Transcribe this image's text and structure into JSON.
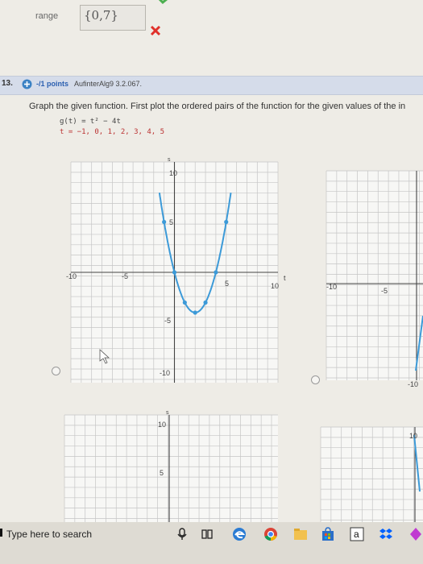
{
  "answer": {
    "range_label": "range",
    "range_value": "{0,7}",
    "status_icon": "wrong-icon",
    "status_color": "#e0302a"
  },
  "question": {
    "number": "13.",
    "points": "-/1 points",
    "code": "AufinterAlg9 3.2.067.",
    "prompt": "Graph the given function. First plot the ordered pairs of the function for the given values of the in",
    "function_text": "g(t) = t² − 4t",
    "t_values_text": "t = −1, 0, 1, 2, 3, 4, 5"
  },
  "graphs": {
    "y_axis_label": "s",
    "x_axis_label": "t",
    "tick_labels": {
      "main_x": [
        "-10",
        "-5",
        "5",
        "10"
      ],
      "main_y": [
        "10",
        "5",
        "-5",
        "-10"
      ],
      "second_x": [
        "-10",
        "-5"
      ],
      "bottom_y": [
        "10",
        "5"
      ],
      "partial": [
        "10",
        "-10"
      ]
    }
  },
  "chart_data": {
    "type": "line",
    "title": "",
    "xlabel": "t",
    "ylabel": "s",
    "xlim": [
      -10,
      10
    ],
    "ylim": [
      -10,
      10
    ],
    "grid": true,
    "series": [
      {
        "x": [
          -1,
          0,
          1,
          2,
          3,
          4,
          5
        ],
        "values": [
          5,
          0,
          -3,
          -4,
          -3,
          0,
          5
        ],
        "color": "#3c9ad8"
      }
    ]
  },
  "taskbar": {
    "search_text": "Type here to search",
    "icons": [
      "microphone-icon",
      "task-view-icon",
      "edge-icon",
      "chrome-icon",
      "files-icon",
      "store-icon",
      "amazon-icon",
      "dropbox-icon",
      "app-icon"
    ]
  }
}
